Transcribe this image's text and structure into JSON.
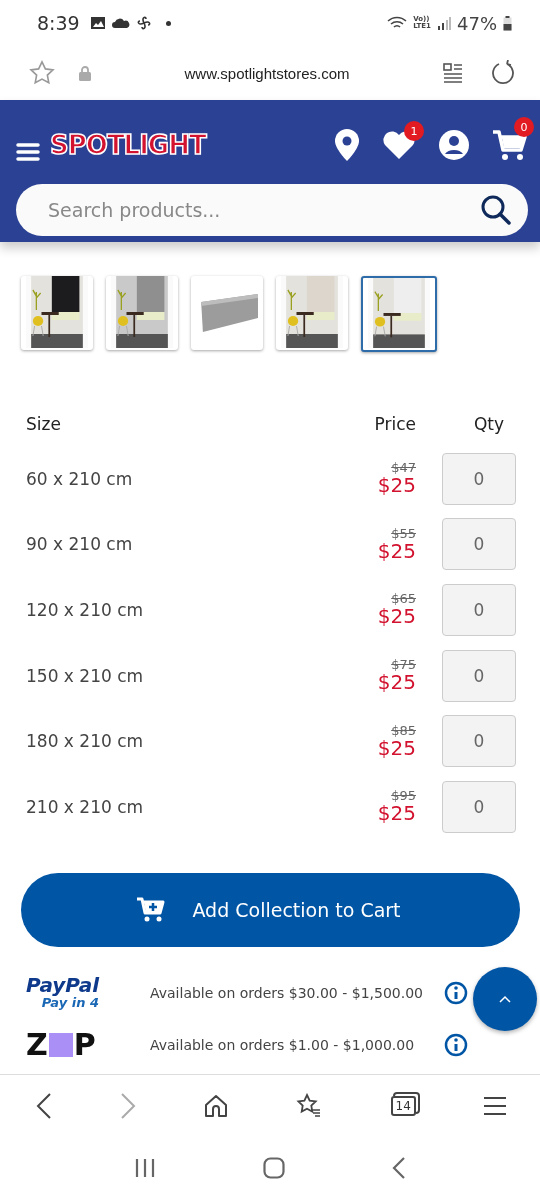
{
  "status_bar": {
    "time": "8:39",
    "network": "Vo))\nLTE1",
    "battery": "47%"
  },
  "browser_bar": {
    "url": "www.spotlightstores.com"
  },
  "header": {
    "logo": "SPOTLIGHT",
    "wishlist_badge": "1",
    "cart_badge": "0",
    "search": {
      "placeholder": "Search products..."
    }
  },
  "colour_swatches": [
    {
      "kind": "picture",
      "selected": false
    },
    {
      "kind": "picture",
      "selected": false
    },
    {
      "kind": "picture",
      "selected": false
    },
    {
      "kind": "picture",
      "selected": false
    },
    {
      "kind": "picture",
      "selected": true
    }
  ],
  "table": {
    "columns": [
      "Size",
      "Price",
      "Qty"
    ],
    "rows": [
      {
        "size": "60 x 210 cm",
        "was": "$47",
        "price": "$25",
        "qty": "0"
      },
      {
        "size": "90 x 210 cm",
        "was": "$55",
        "price": "$25",
        "qty": "0"
      },
      {
        "size": "120 x 210 cm",
        "was": "$65",
        "price": "$25",
        "qty": "0"
      },
      {
        "size": "150 x 210 cm",
        "was": "$75",
        "price": "$25",
        "qty": "0"
      },
      {
        "size": "180 x 210 cm",
        "was": "$85",
        "price": "$25",
        "qty": "0"
      },
      {
        "size": "210 x 210 cm",
        "was": "$95",
        "price": "$25",
        "qty": "0"
      }
    ]
  },
  "add_button": "Add Collection to Cart",
  "payment_options": [
    {
      "kind": "paypal",
      "logo": "PayPal",
      "sub": "Pay in 4",
      "text": "Available on orders $30.00 - $1,500.00"
    },
    {
      "kind": "zip",
      "logo_left": "Z",
      "logo_right": "P",
      "text": "Available on orders $1.00 - $1,000.00"
    }
  ],
  "browser_nav": {
    "tabs_count": "14"
  }
}
